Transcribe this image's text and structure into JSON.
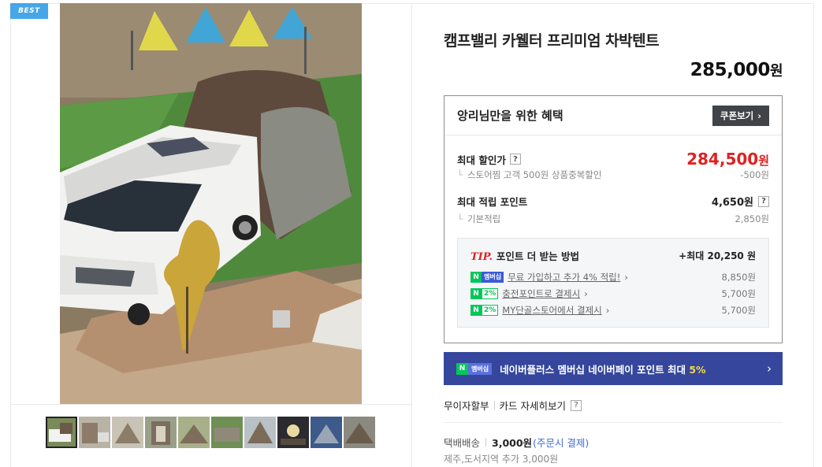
{
  "badge": "BEST",
  "product": {
    "title": "캠프밸리 카웰터 프리미엄 차박텐트",
    "price": "285,000",
    "price_unit": "원"
  },
  "benefit": {
    "title": "앙리님만을 위한 혜택",
    "coupon_button": "쿠폰보기",
    "max_discount_label": "최대 할인가",
    "max_discount_price": "284,500",
    "max_discount_unit": "원",
    "discount_detail_label": "스토어찜 고객 500원 상품중복할인",
    "discount_detail_value": "-500원",
    "max_points_label": "최대 적립 포인트",
    "max_points_value": "4,650원",
    "basic_points_label": "기본적립",
    "basic_points_value": "2,850원",
    "help_glyph": "?",
    "corner_glyph": "└"
  },
  "tip": {
    "tip_word": "TIP.",
    "title": "포인트 더 받는 방법",
    "max": "+최대 20,250 원",
    "items": [
      {
        "badge": "멤버십",
        "badge_type": "membership",
        "text": "무료 가입하고 추가 4% 적립!",
        "value": "8,850원"
      },
      {
        "badge": "2%",
        "badge_type": "percent",
        "text": "충전포인트로 결제시",
        "value": "5,700원"
      },
      {
        "badge": "2%",
        "badge_type": "percent",
        "text": "MY단골스토어에서 결제시",
        "value": "5,700원"
      }
    ]
  },
  "membership_banner": {
    "badge": "멤버십",
    "text": "네이버플러스 멤버십 네이버페이 포인트 최대 ",
    "highlight": "5%"
  },
  "installment": {
    "label": "무이자할부",
    "card_detail": "카드 자세히보기"
  },
  "shipping": {
    "method": "택배배송",
    "fee": "3,000원",
    "note": "(주문시 결제)",
    "jeju": "제주,도서지역 추가 3,000원"
  },
  "thumbnail_count": 10,
  "colors": {
    "accent_red": "#e02020",
    "naver_green": "#03c75a",
    "banner_blue": "#35469c",
    "best_blue": "#46a6e8"
  }
}
